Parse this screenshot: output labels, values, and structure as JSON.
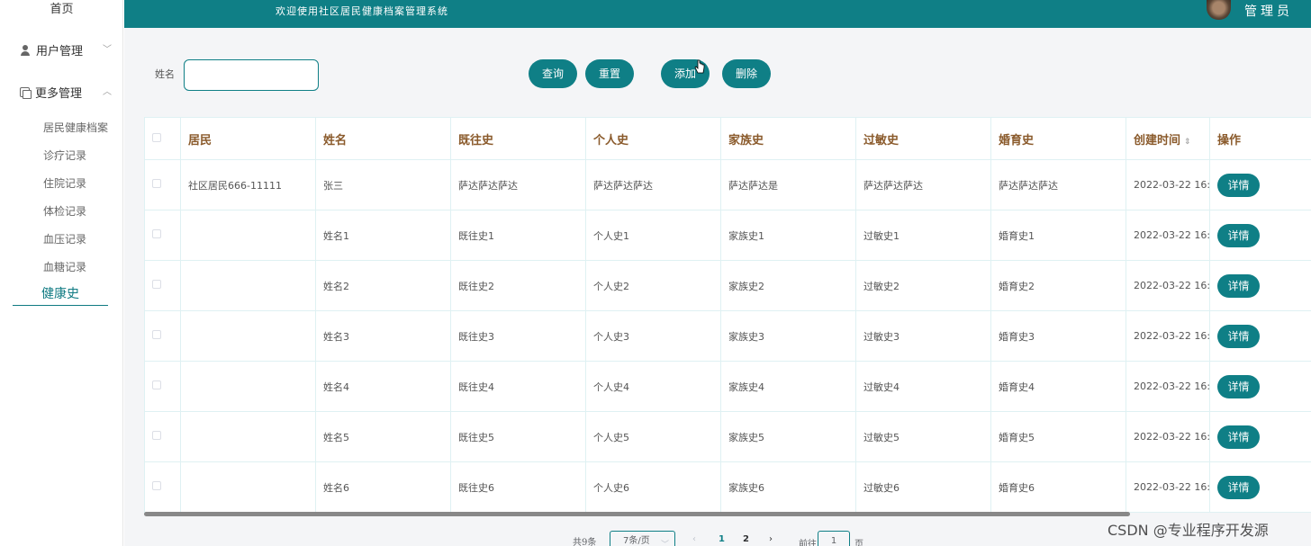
{
  "sidebar": {
    "home": "首页",
    "menus": [
      {
        "label": "用户管理"
      },
      {
        "label": "更多管理"
      }
    ],
    "sub_items": [
      "居民健康档案",
      "诊疗记录",
      "住院记录",
      "体检记录",
      "血压记录",
      "血糖记录"
    ],
    "active_item": "健康史"
  },
  "header": {
    "title": "欢迎使用社区居民健康档案管理系统",
    "user": "管理员"
  },
  "search": {
    "label": "姓名",
    "value": ""
  },
  "buttons": {
    "query": "查询",
    "reset": "重置",
    "add": "添加",
    "delete": "删除"
  },
  "table": {
    "columns": [
      "居民",
      "姓名",
      "既往史",
      "个人史",
      "家族史",
      "过敏史",
      "婚育史",
      "创建时间",
      "操作"
    ],
    "rows": [
      {
        "resident": "社区居民666-11111",
        "name": "张三",
        "past": "萨达萨达萨达",
        "personal": "萨达萨达萨达",
        "family": "萨达萨达是",
        "allergy": "萨达萨达萨达",
        "marital": "萨达萨达萨达",
        "created": "2022-03-22 16:"
      },
      {
        "resident": "",
        "name": "姓名1",
        "past": "既往史1",
        "personal": "个人史1",
        "family": "家族史1",
        "allergy": "过敏史1",
        "marital": "婚育史1",
        "created": "2022-03-22 16:"
      },
      {
        "resident": "",
        "name": "姓名2",
        "past": "既往史2",
        "personal": "个人史2",
        "family": "家族史2",
        "allergy": "过敏史2",
        "marital": "婚育史2",
        "created": "2022-03-22 16:"
      },
      {
        "resident": "",
        "name": "姓名3",
        "past": "既往史3",
        "personal": "个人史3",
        "family": "家族史3",
        "allergy": "过敏史3",
        "marital": "婚育史3",
        "created": "2022-03-22 16:"
      },
      {
        "resident": "",
        "name": "姓名4",
        "past": "既往史4",
        "personal": "个人史4",
        "family": "家族史4",
        "allergy": "过敏史4",
        "marital": "婚育史4",
        "created": "2022-03-22 16:"
      },
      {
        "resident": "",
        "name": "姓名5",
        "past": "既往史5",
        "personal": "个人史5",
        "family": "家族史5",
        "allergy": "过敏史5",
        "marital": "婚育史5",
        "created": "2022-03-22 16:"
      },
      {
        "resident": "",
        "name": "姓名6",
        "past": "既往史6",
        "personal": "个人史6",
        "family": "家族史6",
        "allergy": "过敏史6",
        "marital": "婚育史6",
        "created": "2022-03-22 16:"
      }
    ],
    "detail_label": "详情"
  },
  "pagination": {
    "total": "共9条",
    "page_size": "7条/页",
    "pages": [
      "1",
      "2"
    ],
    "goto_label": "前往",
    "goto_value": "1",
    "page_suffix": "页"
  },
  "watermark": "CSDN @专业程序开发源",
  "colors": {
    "primary": "#0f7f86",
    "header_text": "#8a5a2b"
  }
}
